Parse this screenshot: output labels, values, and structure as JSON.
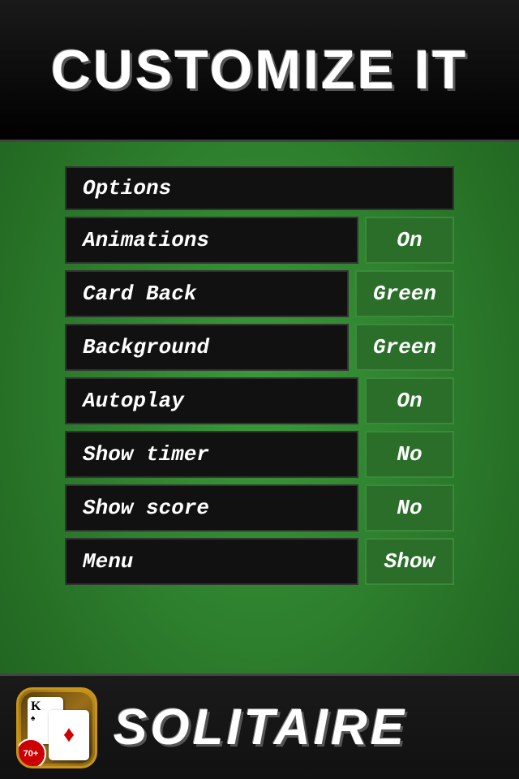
{
  "header": {
    "title": "CUSTOMIZE IT"
  },
  "options": {
    "section_label": "Options",
    "rows": [
      {
        "label": "Animations",
        "value": "On",
        "value_type": "on"
      },
      {
        "label": "Card Back",
        "value": "Green",
        "value_type": "green-val"
      },
      {
        "label": "Background",
        "value": "Green",
        "value_type": "green-val"
      },
      {
        "label": "Autoplay",
        "value": "On",
        "value_type": "on"
      },
      {
        "label": "Show timer",
        "value": "No",
        "value_type": "no-val"
      },
      {
        "label": "Show score",
        "value": "No",
        "value_type": "no-val"
      },
      {
        "label": "Menu",
        "value": "Show",
        "value_type": "show-val"
      }
    ]
  },
  "footer": {
    "badge": "70+",
    "app_name": "SOLITAIRE"
  }
}
